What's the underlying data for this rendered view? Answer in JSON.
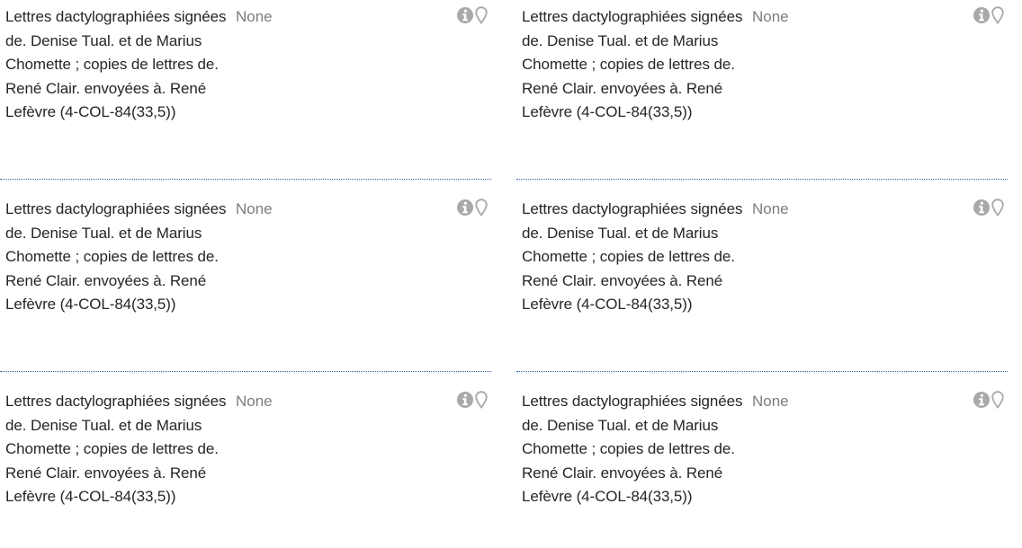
{
  "results": [
    {
      "title": "Lettres dactylographiées signées de. Denise Tual. et de Marius Chomette ; copies de lettres de. René Clair. envoyées à. René Lefèvre (4-COL-84(33,5))",
      "date": "None"
    },
    {
      "title": "Lettres dactylographiées signées de. Denise Tual. et de Marius Chomette ; copies de lettres de. René Clair. envoyées à. René Lefèvre (4-COL-84(33,5))",
      "date": "None"
    },
    {
      "title": "Lettres dactylographiées signées de. Denise Tual. et de Marius Chomette ; copies de lettres de. René Clair. envoyées à. René Lefèvre (4-COL-84(33,5))",
      "date": "None"
    },
    {
      "title": "Lettres dactylographiées signées de. Denise Tual. et de Marius Chomette ; copies de lettres de. René Clair. envoyées à. René Lefèvre (4-COL-84(33,5))",
      "date": "None"
    },
    {
      "title": "Lettres dactylographiées signées de. Denise Tual. et de Marius Chomette ; copies de lettres de. René Clair. envoyées à. René Lefèvre (4-COL-84(33,5))",
      "date": "None"
    },
    {
      "title": "Lettres dactylographiées signées de. Denise Tual. et de Marius Chomette ; copies de lettres de. René Clair. envoyées à. René Lefèvre (4-COL-84(33,5))",
      "date": "None"
    }
  ],
  "icons": {
    "info": "info-icon",
    "location": "map-pin-icon"
  },
  "colors": {
    "title": "#262626",
    "date": "#7d7d7d",
    "icon": "#a9a9a9",
    "rule": "#2e5fa8"
  }
}
